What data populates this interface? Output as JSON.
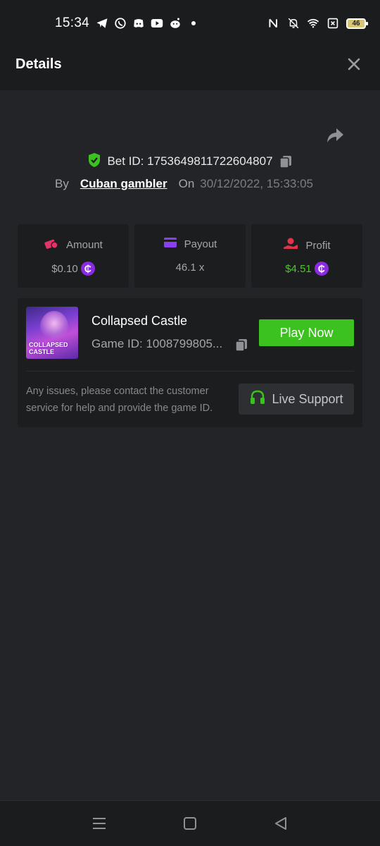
{
  "status_bar": {
    "time": "15:34",
    "left_icons": [
      "telegram-icon",
      "whatsapp-icon",
      "discord-icon",
      "youtube-icon",
      "reddit-icon",
      "dot-icon"
    ],
    "right_icons": [
      "nfc-icon",
      "bell-off-icon",
      "wifi-icon",
      "sim-x-icon"
    ],
    "battery": "46"
  },
  "header": {
    "title": "Details",
    "close_icon": "close-icon"
  },
  "bet": {
    "id_text": "Bet ID: 1753649811722604807",
    "by_label": "By",
    "username": "Cuban gambler",
    "on_label": "On",
    "datetime": "30/12/2022, 15:33:05"
  },
  "stats": [
    {
      "label": "Amount",
      "value": "$0.10",
      "icon": "amount-icon",
      "color": "#e0346a",
      "coin": true,
      "value_color": "#a4a6aa"
    },
    {
      "label": "Payout",
      "value": "46.1 x",
      "icon": "payout-card-icon",
      "color": "#8a3ff0",
      "coin": false,
      "value_color": "#a4a6aa"
    },
    {
      "label": "Profit",
      "value": "$4.51",
      "icon": "profit-icon",
      "color": "#e0344a",
      "coin": true,
      "value_color": "#4ec52b"
    }
  ],
  "coin_symbol": "₵",
  "game": {
    "title": "Collapsed Castle",
    "id_text": "Game ID: 1008799805...",
    "thumb_text_line1": "COLLAPSED",
    "thumb_text_line2": "CASTLE",
    "play_label": "Play Now",
    "play_color": "#3cc21f"
  },
  "support": {
    "text": "Any issues, please contact the customer service for help and provide the game ID.",
    "button_label": "Live Support",
    "icon": "headset-icon",
    "icon_color": "#3cc21f"
  },
  "nav": [
    "menu-icon",
    "home-icon",
    "back-icon"
  ]
}
